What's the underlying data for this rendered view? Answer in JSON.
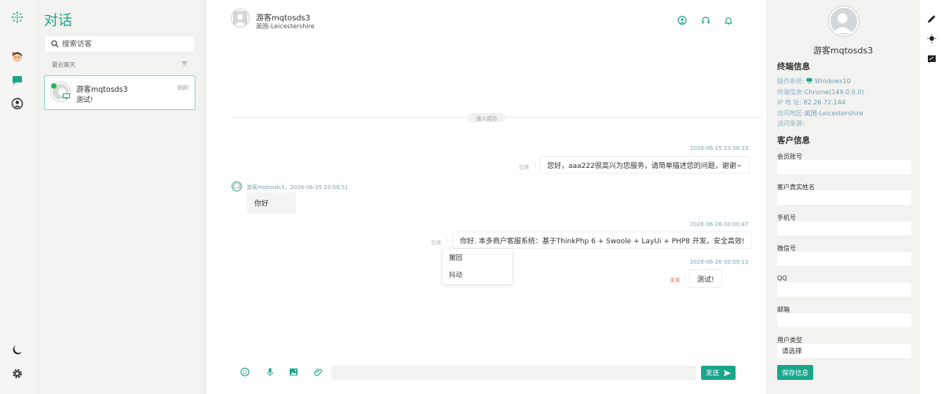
{
  "list": {
    "title": "对话",
    "search_placeholder": "搜索访客",
    "recent_label": "最近聊天",
    "conversation": {
      "name": "游客mqtosds3",
      "time": "刚刚",
      "last_message": "测试!"
    }
  },
  "chat": {
    "visitor_name": "游客mqtosds3",
    "visitor_location": "英国-Leicestershire",
    "system_notice": "接入成功",
    "messages": [
      {
        "time": "2026-06-25 23:58:33",
        "status": "已读",
        "text": "您好，aaa222很高兴为您服务，请简单描述您的问题，谢谢~"
      },
      {
        "header": "游客mqtosds3，2026-06-25 23:58:51",
        "text": "你好"
      },
      {
        "time": "2026-06-26 00:00:47",
        "status": "已读",
        "text": "你好. 本多商户客服系统：基于ThinkPhp 6 + Swoole + LayUi + PHP8 开发。安全高效!"
      },
      {
        "time": "2026-06-26 00:09:13",
        "status": "未读",
        "text": "测试!"
      }
    ],
    "context_menu": [
      "撤回",
      "抖动"
    ],
    "send_label": "发送"
  },
  "side": {
    "name": "游客mqtosds3",
    "terminal_title": "终端信息",
    "os_label": "操作系统:",
    "os_value": "Windows10",
    "ua_label": "终端信息:",
    "ua_value": "Chrome(149.0.0.0)",
    "ip_label": "IP 地 址:",
    "ip_value": "82.26.72.144",
    "region_label": "访问地区:",
    "region_value": "英国-Leicestershire",
    "source_label": "访问来源:",
    "customer_title": "客户信息",
    "fields": [
      "会员账号",
      "客户真实姓名",
      "手机号",
      "微信号",
      "QQ",
      "邮箱"
    ],
    "type_label": "用户类型",
    "type_value": "请选择",
    "save_label": "保存信息"
  },
  "colors": {
    "accent": "#1aa68a",
    "unread": "#e06b4c"
  }
}
